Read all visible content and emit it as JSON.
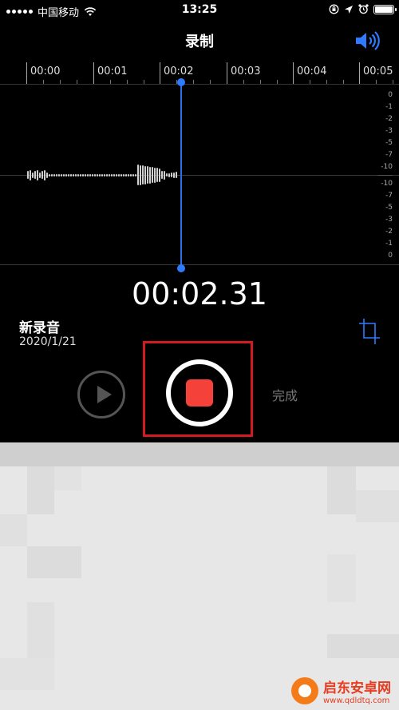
{
  "status_bar": {
    "carrier": "中国移动",
    "time": "13:25"
  },
  "nav": {
    "title": "录制",
    "speaker_icon": "speaker-wave-icon",
    "accent_color": "#2f7bff"
  },
  "timeline": {
    "labels": [
      "00:00",
      "00:01",
      "00:02",
      "00:03",
      "00:04",
      "00:05"
    ]
  },
  "meter_db": {
    "top": [
      "0",
      "-1",
      "-2",
      "-3",
      "-5",
      "-7",
      "-10"
    ],
    "bottom": [
      "-10",
      "-7",
      "-5",
      "-3",
      "-2",
      "-1",
      "0"
    ]
  },
  "recording": {
    "elapsed": "00:02.31",
    "name": "新录音",
    "date": "2020/1/21"
  },
  "controls": {
    "play_icon": "play-icon",
    "stop_icon": "stop-record-icon",
    "done_label": "完成",
    "stop_color": "#f4413a",
    "highlight_color": "#d51920"
  },
  "watermark": {
    "name": "启东安卓网",
    "url": "www.qdldtq.com"
  }
}
